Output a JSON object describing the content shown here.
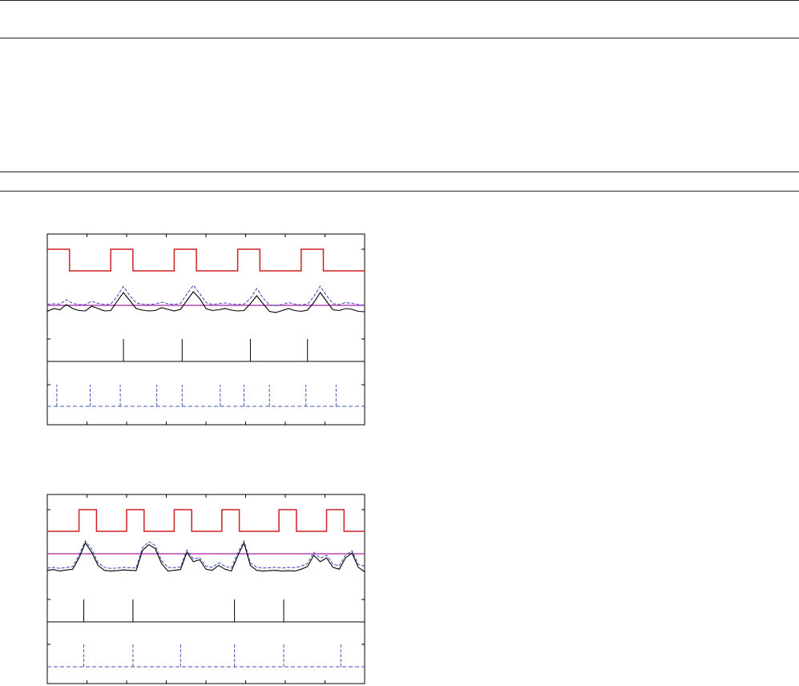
{
  "colors": {
    "frame": "#000000",
    "stimulus": "#cc2222",
    "threshold": "#aa22aa",
    "signal_a": "#000000",
    "signal_b": "#4455bb"
  },
  "chart_data": [
    {
      "type": "line",
      "x_range": [
        0,
        1000
      ],
      "tracks": {
        "stimulus": {
          "range": [
            0,
            1
          ],
          "x": [
            0,
            70,
            70,
            200,
            200,
            270,
            270,
            400,
            400,
            470,
            470,
            600,
            600,
            670,
            670,
            800,
            800,
            870,
            870,
            1000
          ],
          "y": [
            1,
            1,
            0,
            0,
            1,
            1,
            0,
            0,
            1,
            1,
            0,
            0,
            1,
            1,
            0,
            0,
            1,
            1,
            0,
            0
          ]
        },
        "threshold": {
          "value": 0.5
        },
        "signal_a": {
          "range": [
            0,
            1
          ],
          "x": [
            0,
            20,
            40,
            60,
            80,
            100,
            120,
            140,
            160,
            180,
            200,
            220,
            240,
            260,
            280,
            300,
            320,
            340,
            360,
            380,
            400,
            420,
            440,
            460,
            480,
            500,
            520,
            540,
            560,
            580,
            600,
            620,
            640,
            660,
            680,
            700,
            720,
            740,
            760,
            780,
            800,
            820,
            840,
            860,
            880,
            900,
            920,
            940,
            960,
            980,
            1000
          ],
          "y": [
            0.23,
            0.3,
            0.27,
            0.4,
            0.3,
            0.25,
            0.24,
            0.36,
            0.3,
            0.24,
            0.25,
            0.48,
            0.7,
            0.5,
            0.3,
            0.26,
            0.24,
            0.25,
            0.32,
            0.28,
            0.24,
            0.28,
            0.5,
            0.72,
            0.55,
            0.3,
            0.25,
            0.27,
            0.3,
            0.26,
            0.24,
            0.25,
            0.42,
            0.62,
            0.42,
            0.23,
            0.2,
            0.25,
            0.3,
            0.25,
            0.23,
            0.26,
            0.45,
            0.7,
            0.48,
            0.27,
            0.25,
            0.3,
            0.28,
            0.23,
            0.22
          ]
        },
        "signal_b": {
          "range": [
            0,
            1
          ],
          "x": [
            0,
            20,
            40,
            60,
            80,
            100,
            120,
            140,
            160,
            180,
            200,
            220,
            240,
            260,
            280,
            300,
            320,
            340,
            360,
            380,
            400,
            420,
            440,
            460,
            480,
            500,
            520,
            540,
            560,
            580,
            600,
            620,
            640,
            660,
            680,
            700,
            720,
            740,
            760,
            780,
            800,
            820,
            840,
            860,
            880,
            900,
            920,
            940,
            960,
            980,
            1000
          ],
          "y": [
            0.4,
            0.42,
            0.41,
            0.52,
            0.43,
            0.4,
            0.4,
            0.48,
            0.43,
            0.4,
            0.41,
            0.6,
            0.85,
            0.62,
            0.44,
            0.41,
            0.4,
            0.41,
            0.46,
            0.42,
            0.4,
            0.43,
            0.66,
            0.88,
            0.68,
            0.45,
            0.4,
            0.42,
            0.44,
            0.41,
            0.4,
            0.41,
            0.55,
            0.8,
            0.56,
            0.39,
            0.37,
            0.4,
            0.45,
            0.41,
            0.39,
            0.41,
            0.6,
            0.86,
            0.62,
            0.42,
            0.4,
            0.45,
            0.43,
            0.4,
            0.38
          ]
        },
        "events_a": {
          "x": [
            240,
            425,
            640,
            820
          ]
        },
        "events_b": {
          "x": [
            30,
            135,
            230,
            345,
            425,
            545,
            620,
            700,
            815,
            910
          ]
        }
      }
    },
    {
      "type": "line",
      "x_range": [
        0,
        1000
      ],
      "tracks": {
        "stimulus": {
          "range": [
            0,
            1
          ],
          "x": [
            0,
            100,
            100,
            155,
            155,
            250,
            250,
            305,
            305,
            400,
            400,
            455,
            455,
            550,
            550,
            605,
            605,
            730,
            730,
            785,
            785,
            880,
            880,
            935,
            935,
            1000
          ],
          "y": [
            0,
            0,
            1,
            1,
            0,
            0,
            1,
            1,
            0,
            0,
            1,
            1,
            0,
            0,
            1,
            1,
            0,
            0,
            1,
            1,
            0,
            0,
            1,
            1,
            0,
            0
          ]
        },
        "threshold": {
          "value": 0.8
        },
        "signal_a": {
          "range": [
            0,
            1
          ],
          "x": [
            0,
            20,
            40,
            60,
            80,
            100,
            120,
            140,
            160,
            180,
            200,
            220,
            240,
            260,
            280,
            300,
            320,
            340,
            360,
            380,
            400,
            420,
            440,
            460,
            480,
            500,
            520,
            540,
            560,
            580,
            600,
            620,
            640,
            660,
            680,
            700,
            720,
            740,
            760,
            780,
            800,
            820,
            840,
            860,
            880,
            900,
            920,
            940,
            960,
            980,
            1000
          ],
          "y": [
            0.22,
            0.24,
            0.2,
            0.23,
            0.25,
            0.55,
            0.95,
            0.7,
            0.35,
            0.22,
            0.2,
            0.21,
            0.23,
            0.22,
            0.21,
            0.75,
            0.9,
            0.8,
            0.4,
            0.2,
            0.22,
            0.24,
            0.7,
            0.45,
            0.5,
            0.25,
            0.22,
            0.35,
            0.25,
            0.2,
            0.6,
            0.95,
            0.35,
            0.22,
            0.2,
            0.21,
            0.22,
            0.2,
            0.21,
            0.2,
            0.25,
            0.32,
            0.62,
            0.45,
            0.55,
            0.3,
            0.25,
            0.55,
            0.68,
            0.3,
            0.18
          ]
        },
        "signal_b": {
          "range": [
            0,
            1
          ],
          "x": [
            0,
            20,
            40,
            60,
            80,
            100,
            120,
            140,
            160,
            180,
            200,
            220,
            240,
            260,
            280,
            300,
            320,
            340,
            360,
            380,
            400,
            420,
            440,
            460,
            480,
            500,
            520,
            540,
            560,
            580,
            600,
            620,
            640,
            660,
            680,
            700,
            720,
            740,
            760,
            780,
            800,
            820,
            840,
            860,
            880,
            900,
            920,
            940,
            960,
            980,
            1000
          ],
          "y": [
            0.28,
            0.3,
            0.27,
            0.3,
            0.32,
            0.62,
            1.0,
            0.78,
            0.42,
            0.3,
            0.27,
            0.28,
            0.3,
            0.29,
            0.28,
            0.82,
            0.98,
            0.88,
            0.48,
            0.3,
            0.29,
            0.31,
            0.76,
            0.52,
            0.56,
            0.33,
            0.3,
            0.42,
            0.33,
            0.28,
            0.68,
            1.0,
            0.42,
            0.3,
            0.28,
            0.29,
            0.3,
            0.28,
            0.3,
            0.29,
            0.33,
            0.4,
            0.7,
            0.54,
            0.62,
            0.38,
            0.34,
            0.62,
            0.74,
            0.38,
            0.33
          ]
        },
        "events_a": {
          "x": [
            115,
            270,
            590,
            745
          ]
        },
        "events_b": {
          "x": [
            115,
            270,
            420,
            590,
            745,
            925
          ]
        }
      }
    }
  ]
}
